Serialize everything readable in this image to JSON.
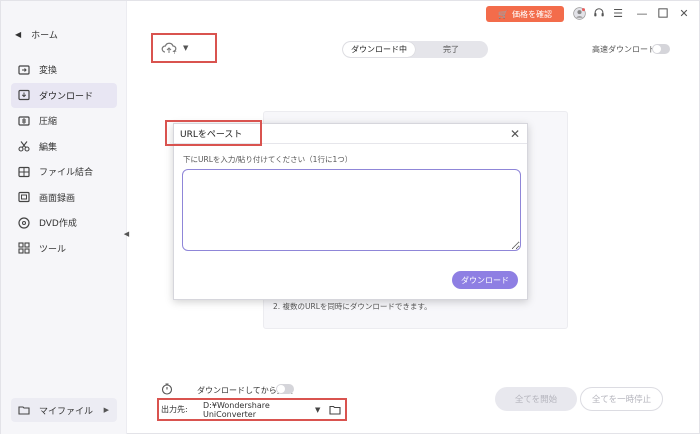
{
  "titlebar": {
    "price_button": "価格を確認",
    "icons": [
      "user-icon",
      "support-icon",
      "menu-icon",
      "minimize-icon",
      "maximize-icon",
      "close-icon"
    ]
  },
  "sidebar": {
    "home": "ホーム",
    "items": [
      {
        "label": "変換",
        "icon": "convert-icon",
        "active": false
      },
      {
        "label": "ダウンロード",
        "icon": "download-icon",
        "active": true
      },
      {
        "label": "圧縮",
        "icon": "compress-icon",
        "active": false
      },
      {
        "label": "編集",
        "icon": "edit-icon",
        "active": false
      },
      {
        "label": "ファイル結合",
        "icon": "merge-icon",
        "active": false
      },
      {
        "label": "画面録画",
        "icon": "record-icon",
        "active": false
      },
      {
        "label": "DVD作成",
        "icon": "dvd-icon",
        "active": false
      },
      {
        "label": "ツール",
        "icon": "toolbox-icon",
        "active": false
      }
    ],
    "my_files": "マイファイル"
  },
  "toolbar": {
    "tabs": [
      {
        "label": "ダウンロード中",
        "active": true
      },
      {
        "label": "完了",
        "active": false
      }
    ],
    "high_speed_label": "高速ダウンロード"
  },
  "background": {
    "tip": "2. 複数のURLを同時にダウンロードできます。"
  },
  "dialog": {
    "title": "URLをペースト",
    "hint": "下にURLを入力/貼り付けてください（1行に1つ）",
    "textarea_value": "",
    "download_button": "ダウンロード"
  },
  "footer": {
    "convert_after_label": "ダウンロードしてから変換",
    "output_label": "出力先:",
    "output_path": "D:¥Wondershare UniConverter",
    "start_all": "全てを開始",
    "pause_all": "全てを一時停止"
  },
  "colors": {
    "accent": "#8e7fe3",
    "price": "#f36c4b",
    "highlight": "#d9534f"
  }
}
